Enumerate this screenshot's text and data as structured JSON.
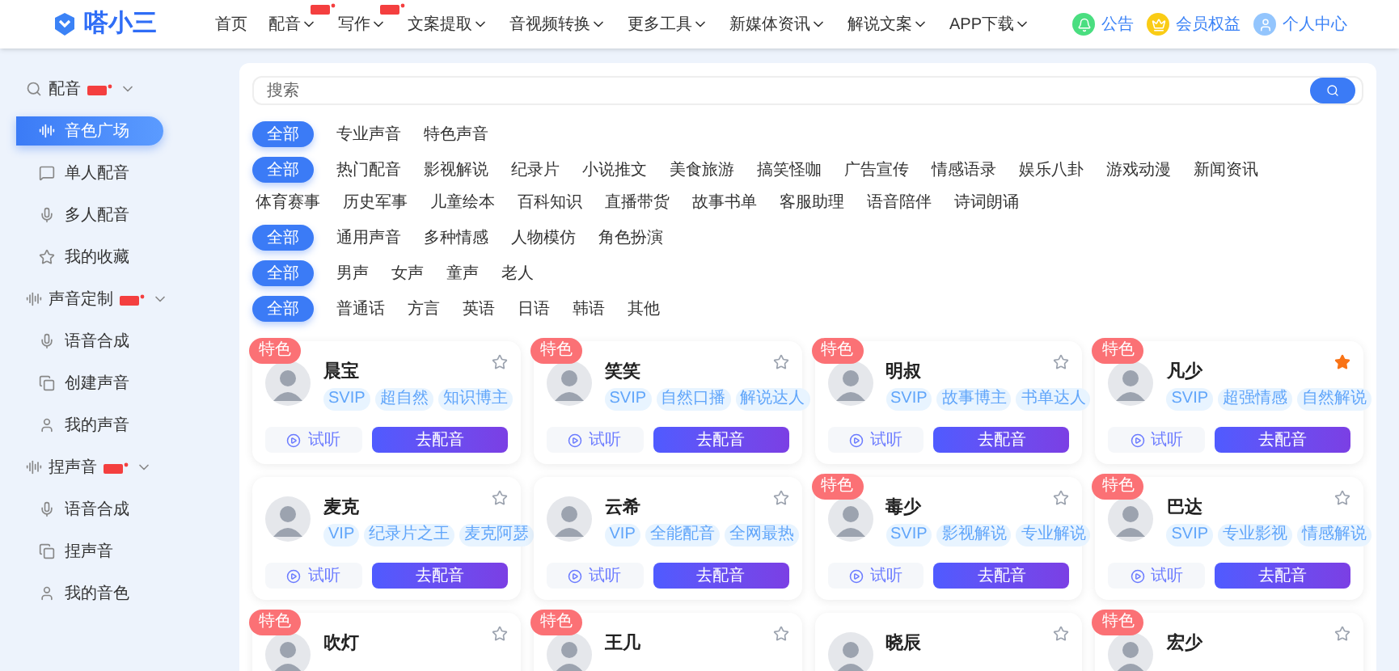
{
  "header": {
    "logo": "嗒小三",
    "nav": [
      {
        "label": "首页",
        "hot": false,
        "dropdown": false
      },
      {
        "label": "配音",
        "hot": true,
        "dropdown": true
      },
      {
        "label": "写作",
        "hot": true,
        "dropdown": true
      },
      {
        "label": "文案提取",
        "hot": false,
        "dropdown": true
      },
      {
        "label": "音视频转换",
        "hot": false,
        "dropdown": true
      },
      {
        "label": "更多工具",
        "hot": false,
        "dropdown": true
      },
      {
        "label": "新媒体资讯",
        "hot": false,
        "dropdown": true
      },
      {
        "label": "解说文案",
        "hot": false,
        "dropdown": true
      },
      {
        "label": "APP下载",
        "hot": false,
        "dropdown": true
      }
    ],
    "links": [
      "公告",
      "会员权益",
      "个人中心"
    ]
  },
  "sidebar": [
    {
      "label": "配音",
      "hot": true,
      "expanded": true,
      "children": [
        {
          "label": "音色广场",
          "selected": true
        },
        {
          "label": "单人配音",
          "selected": false
        },
        {
          "label": "多人配音",
          "selected": false
        },
        {
          "label": "我的收藏",
          "selected": false
        }
      ]
    },
    {
      "label": "声音定制",
      "hot": true,
      "expanded": true,
      "children": [
        {
          "label": "语音合成",
          "selected": false
        },
        {
          "label": "创建声音",
          "selected": false
        },
        {
          "label": "我的声音",
          "selected": false
        }
      ]
    },
    {
      "label": "捏声音",
      "hot": true,
      "expanded": true,
      "children": [
        {
          "label": "语音合成",
          "selected": false
        },
        {
          "label": "捏声音",
          "selected": false
        },
        {
          "label": "我的音色",
          "selected": false
        }
      ]
    }
  ],
  "search": {
    "placeholder": "搜索"
  },
  "filters": [
    [
      {
        "label": "全部",
        "selected": true
      },
      {
        "label": "专业声音",
        "selected": false
      },
      {
        "label": "特色声音",
        "selected": false
      }
    ],
    [
      {
        "label": "全部",
        "selected": true
      },
      {
        "label": "热门配音",
        "selected": false
      },
      {
        "label": "影视解说",
        "selected": false
      },
      {
        "label": "纪录片",
        "selected": false
      },
      {
        "label": "小说推文",
        "selected": false
      },
      {
        "label": "美食旅游",
        "selected": false
      },
      {
        "label": "搞笑怪咖",
        "selected": false
      },
      {
        "label": "广告宣传",
        "selected": false
      },
      {
        "label": "情感语录",
        "selected": false
      },
      {
        "label": "娱乐八卦",
        "selected": false
      },
      {
        "label": "游戏动漫",
        "selected": false
      },
      {
        "label": "新闻资讯",
        "selected": false
      },
      {
        "label": "体育赛事",
        "selected": false
      },
      {
        "label": "历史军事",
        "selected": false
      },
      {
        "label": "儿童绘本",
        "selected": false
      },
      {
        "label": "百科知识",
        "selected": false
      },
      {
        "label": "直播带货",
        "selected": false
      },
      {
        "label": "故事书单",
        "selected": false
      },
      {
        "label": "客服助理",
        "selected": false
      },
      {
        "label": "语音陪伴",
        "selected": false
      },
      {
        "label": "诗词朗诵",
        "selected": false
      }
    ],
    [
      {
        "label": "全部",
        "selected": true
      },
      {
        "label": "通用声音",
        "selected": false
      },
      {
        "label": "多种情感",
        "selected": false
      },
      {
        "label": "人物模仿",
        "selected": false
      },
      {
        "label": "角色扮演",
        "selected": false
      }
    ],
    [
      {
        "label": "全部",
        "selected": true
      },
      {
        "label": "男声",
        "selected": false
      },
      {
        "label": "女声",
        "selected": false
      },
      {
        "label": "童声",
        "selected": false
      },
      {
        "label": "老人",
        "selected": false
      }
    ],
    [
      {
        "label": "全部",
        "selected": true
      },
      {
        "label": "普通话",
        "selected": false
      },
      {
        "label": "方言",
        "selected": false
      },
      {
        "label": "英语",
        "selected": false
      },
      {
        "label": "日语",
        "selected": false
      },
      {
        "label": "韩语",
        "selected": false
      },
      {
        "label": "其他",
        "selected": false
      }
    ]
  ],
  "voices": [
    {
      "name": "晨宝",
      "badge": "特色",
      "favorite": false,
      "tags": [
        "SVIP",
        "超自然",
        "知识博主"
      ],
      "listen": "试听",
      "use": "去配音"
    },
    {
      "name": "笑笑",
      "badge": "特色",
      "favorite": false,
      "tags": [
        "SVIP",
        "自然口播",
        "解说达人"
      ],
      "listen": "试听",
      "use": "去配音"
    },
    {
      "name": "明叔",
      "badge": "特色",
      "favorite": false,
      "tags": [
        "SVIP",
        "故事博主",
        "书单达人"
      ],
      "listen": "试听",
      "use": "去配音"
    },
    {
      "name": "凡少",
      "badge": "特色",
      "favorite": true,
      "tags": [
        "SVIP",
        "超强情感",
        "自然解说"
      ],
      "listen": "试听",
      "use": "去配音"
    },
    {
      "name": "麦克",
      "favorite": false,
      "tags": [
        "VIP",
        "纪录片之王",
        "麦克阿瑟"
      ],
      "listen": "试听",
      "use": "去配音"
    },
    {
      "name": "云希",
      "favorite": false,
      "tags": [
        "VIP",
        "全能配音",
        "全网最热"
      ],
      "listen": "试听",
      "use": "去配音"
    },
    {
      "name": "毒少",
      "badge": "特色",
      "favorite": false,
      "tags": [
        "SVIP",
        "影视解说",
        "专业解说"
      ],
      "listen": "试听",
      "use": "去配音"
    },
    {
      "name": "巴达",
      "badge": "特色",
      "favorite": false,
      "tags": [
        "SVIP",
        "专业影视",
        "情感解说"
      ],
      "listen": "试听",
      "use": "去配音"
    },
    {
      "name": "吹灯",
      "badge": "特色",
      "favorite": false
    },
    {
      "name": "王几",
      "badge": "特色",
      "favorite": false
    },
    {
      "name": "晓辰",
      "favorite": false
    },
    {
      "name": "宏少",
      "badge": "特色",
      "favorite": false
    }
  ]
}
